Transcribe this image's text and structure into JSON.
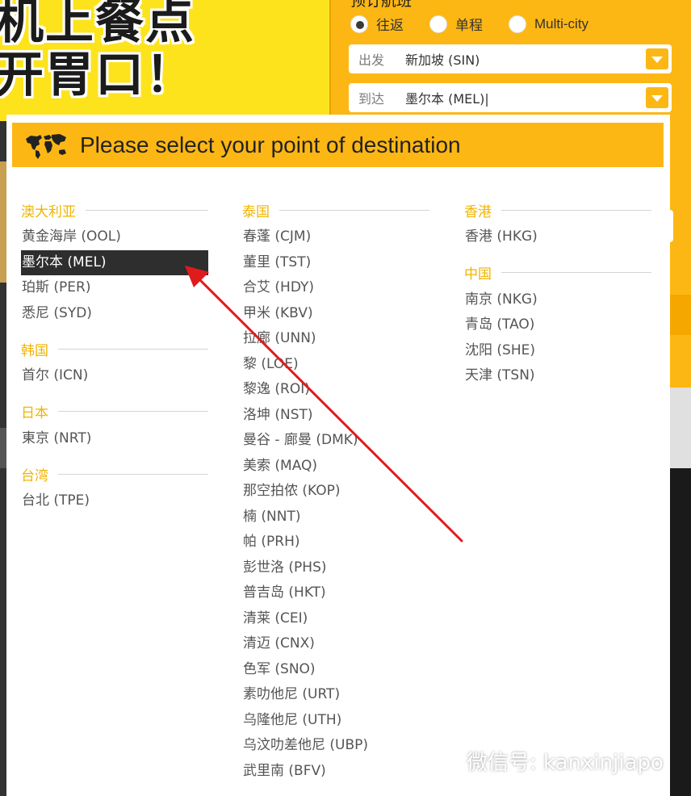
{
  "promo": {
    "line1": "机上餐点",
    "line2": "开胃口！"
  },
  "booking": {
    "title": "预订航班",
    "trip_types": [
      {
        "label": "往返",
        "selected": true
      },
      {
        "label": "单程",
        "selected": false
      },
      {
        "label": "Multi-city",
        "selected": false
      }
    ],
    "from": {
      "label": "出发",
      "value": "新加坡 (SIN)"
    },
    "to": {
      "label": "到达",
      "value": "墨尔本 (MEL)|"
    }
  },
  "modal": {
    "title": "Please select your point of destination",
    "icon": "world-map-icon",
    "selected_city": "墨尔本 (MEL)",
    "columns": [
      [
        {
          "region": "澳大利亚",
          "cities": [
            "黄金海岸 (OOL)",
            "墨尔本 (MEL)",
            "珀斯 (PER)",
            "悉尼 (SYD)"
          ]
        },
        {
          "region": "韩国",
          "cities": [
            "首尔 (ICN)"
          ]
        },
        {
          "region": "日本",
          "cities": [
            "東京 (NRT)"
          ]
        },
        {
          "region": "台湾",
          "cities": [
            "台北 (TPE)"
          ]
        }
      ],
      [
        {
          "region": "泰国",
          "cities": [
            "春蓬 (CJM)",
            "董里 (TST)",
            "合艾 (HDY)",
            "甲米 (KBV)",
            "拉廊 (UNN)",
            "黎 (LOE)",
            "黎逸 (ROI)",
            "洛坤 (NST)",
            "曼谷 - 廊曼 (DMK)",
            "美索 (MAQ)",
            "那空拍侬 (KOP)",
            "楠 (NNT)",
            "帕 (PRH)",
            "彭世洛 (PHS)",
            "普吉岛 (HKT)",
            "清莱 (CEI)",
            "清迈 (CNX)",
            "色军 (SNO)",
            "素叻他尼 (URT)",
            "乌隆他尼 (UTH)",
            "乌汶叻差他尼 (UBP)",
            "武里南 (BFV)"
          ]
        }
      ],
      [
        {
          "region": "香港",
          "cities": [
            "香港 (HKG)"
          ]
        },
        {
          "region": "中国",
          "cities": [
            "南京 (NKG)",
            "青岛 (TAO)",
            "沈阳 (SHE)",
            "天津 (TSN)"
          ]
        }
      ]
    ]
  },
  "watermark": "微信号: kanxinjiapo",
  "colors": {
    "accent": "#fdb714",
    "region": "#f0b400",
    "selected_bg": "#2e2e2e",
    "arrow": "#e01b1b"
  }
}
